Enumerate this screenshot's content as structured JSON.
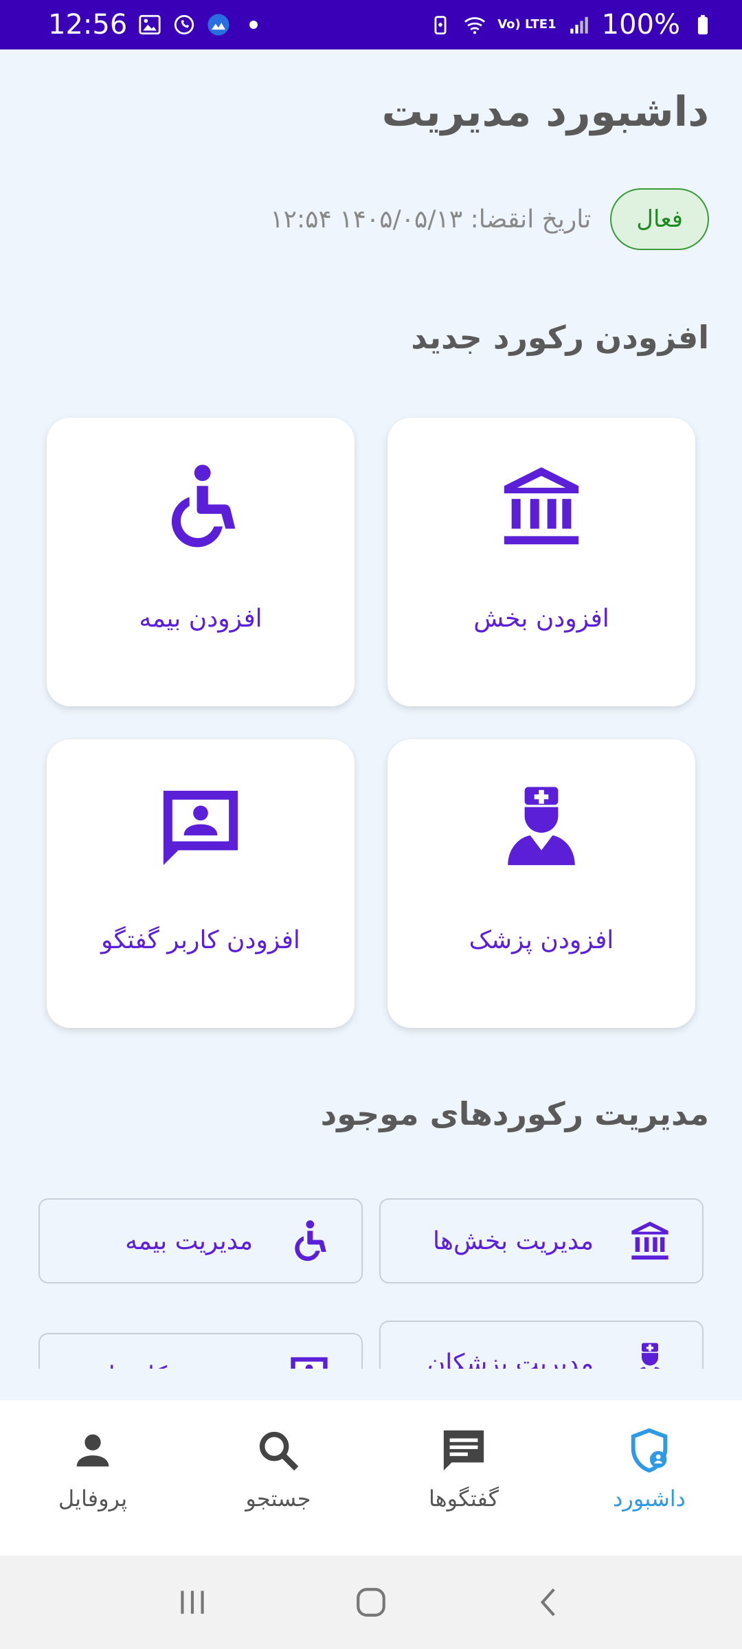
{
  "status_bar": {
    "time": "12:56",
    "battery": "100%",
    "network_label": "Vo) LTE1"
  },
  "header": {
    "title": "داشبورد مدیریت",
    "status_badge": "فعال",
    "expiry": "تاریخ انقضا: ۱۴۰۵/۰۵/۱۳ ۱۲:۵۴"
  },
  "add_section": {
    "title": "افزودن رکورد جدید",
    "cards": {
      "department": {
        "label": "افزودن بخش",
        "icon": "bank-icon"
      },
      "insurance": {
        "label": "افزودن بیمه",
        "icon": "wheelchair-icon"
      },
      "doctor": {
        "label": "افزودن پزشک",
        "icon": "doctor-icon"
      },
      "chat_user": {
        "label": "افزودن کاربر گفتگو",
        "icon": "chat-contact-icon"
      }
    }
  },
  "manage_section": {
    "title": "مدیریت رکوردهای موجود",
    "buttons": {
      "departments": "مدیریت بخش‌ها",
      "insurance": "مدیریت بیمه",
      "doctors": "مدیریت پزشکان",
      "users": "مدیریت کاربران"
    }
  },
  "bottom_nav": {
    "dashboard": "داشبورد",
    "chats": "گفتگوها",
    "search": "جستجو",
    "profile": "پروفایل"
  },
  "colors": {
    "accent": "#5a1fd6",
    "status_bar": "#3a00b8",
    "nav_active": "#2e9ae6",
    "badge_green": "#1f8a1f",
    "background": "#eef5fc"
  }
}
